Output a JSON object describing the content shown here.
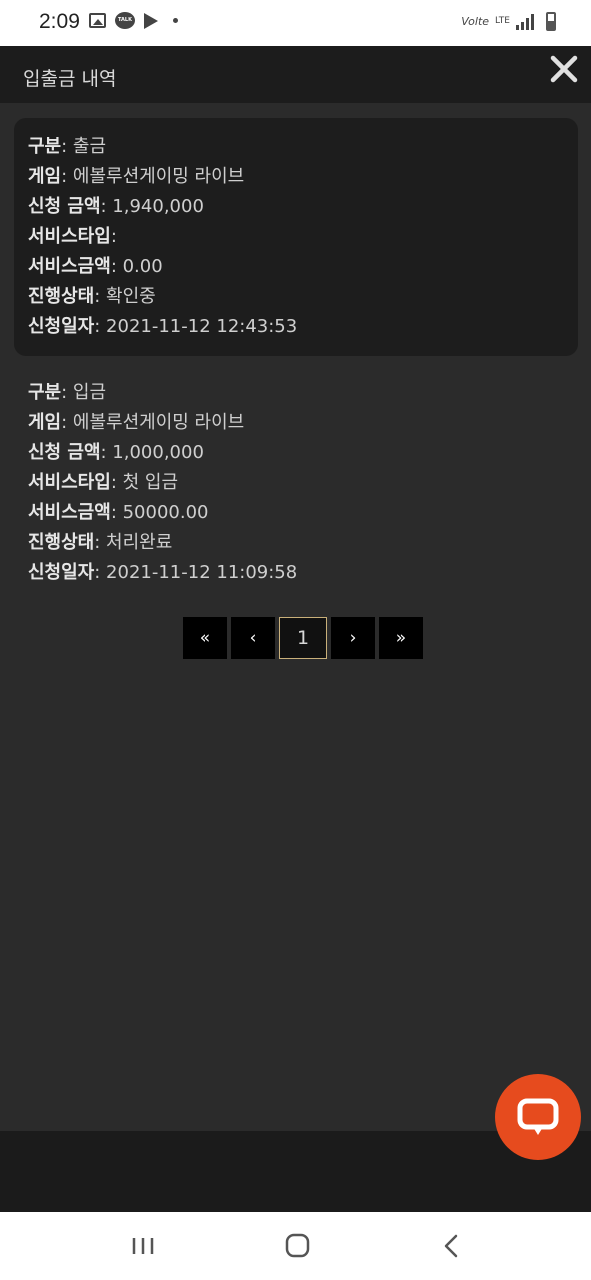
{
  "status_bar": {
    "time": "2:09",
    "left_icons": [
      "gallery-icon",
      "talk-icon",
      "play-store-icon",
      "dot-icon"
    ],
    "volte": "Volte",
    "network": "LTE",
    "right_icons": [
      "signal-icon",
      "battery-icon"
    ]
  },
  "header": {
    "title": "입출금 내역",
    "close_icon": "close-icon"
  },
  "records": [
    {
      "type_label": "구분",
      "type_value": ": 출금",
      "game_label": "게임",
      "game_value": ": 에볼루션게이밍 라이브",
      "amount_label": "신청 금액",
      "amount_value": ": 1,940,000",
      "service_type_label": "서비스타입",
      "service_type_value": ":",
      "service_amount_label": "서비스금액",
      "service_amount_value": ": 0.00",
      "status_label": "진행상태",
      "status_value": ": 확인중",
      "date_label": "신청일자",
      "date_value": ": 2021-11-12 12:43:53"
    },
    {
      "type_label": "구분",
      "type_value": ": 입금",
      "game_label": "게임",
      "game_value": ": 에볼루션게이밍 라이브",
      "amount_label": "신청 금액",
      "amount_value": ": 1,000,000",
      "service_type_label": "서비스타입",
      "service_type_value": ": 첫 입금",
      "service_amount_label": "서비스금액",
      "service_amount_value": ": 50000.00",
      "status_label": "진행상태",
      "status_value": ": 처리완료",
      "date_label": "신청일자",
      "date_value": ": 2021-11-12 11:09:58"
    }
  ],
  "pagination": {
    "first": "«",
    "prev": "‹",
    "current": "1",
    "next": "›",
    "last": "»"
  },
  "chat_fab": {
    "icon": "chat-icon",
    "color": "#e64b1e"
  },
  "nav_bar": {
    "recent_icon": "recent-apps-icon",
    "home_icon": "home-icon",
    "back_icon": "back-icon"
  }
}
